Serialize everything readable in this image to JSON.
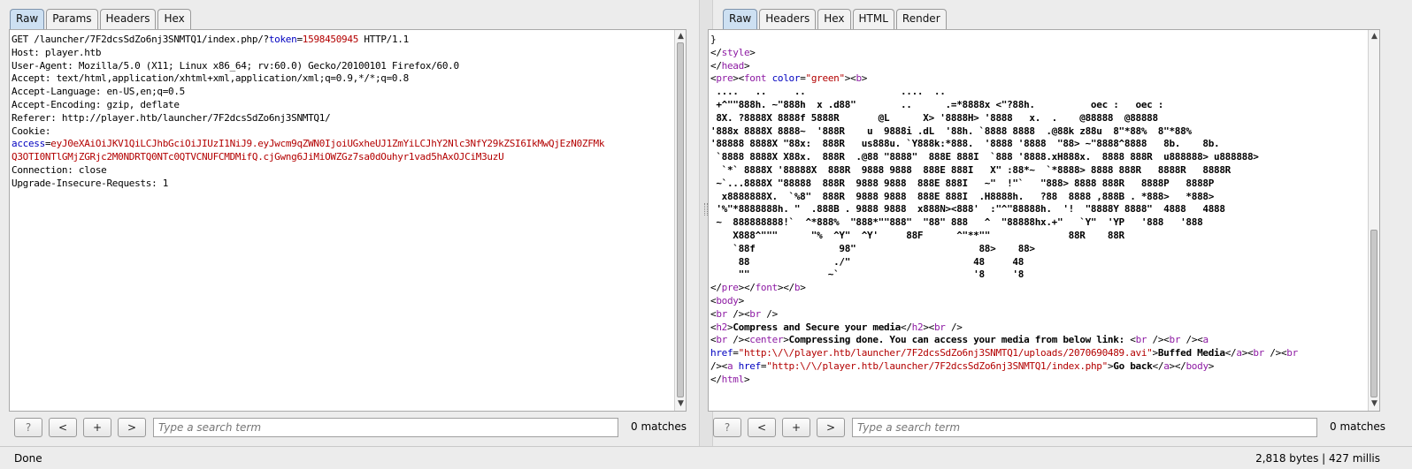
{
  "request": {
    "tabs": [
      "Raw",
      "Params",
      "Headers",
      "Hex"
    ],
    "active_tab": "Raw",
    "lines": [
      [
        {
          "t": "GET /launcher/7F2dcsSdZo6nj3SNMTQ1/index.php/?"
        },
        {
          "t": "token",
          "c": "blue"
        },
        {
          "t": "="
        },
        {
          "t": "1598450945",
          "c": "red"
        },
        {
          "t": " HTTP/1.1"
        }
      ],
      [
        {
          "t": "Host: player.htb"
        }
      ],
      [
        {
          "t": "User-Agent: Mozilla/5.0 (X11; Linux x86_64; rv:60.0) Gecko/20100101 Firefox/60.0"
        }
      ],
      [
        {
          "t": "Accept: text/html,application/xhtml+xml,application/xml;q=0.9,*/*;q=0.8"
        }
      ],
      [
        {
          "t": "Accept-Language: en-US,en;q=0.5"
        }
      ],
      [
        {
          "t": "Accept-Encoding: gzip, deflate"
        }
      ],
      [
        {
          "t": "Referer: http://player.htb/launcher/7F2dcsSdZo6nj3SNMTQ1/"
        }
      ],
      [
        {
          "t": "Cookie:"
        }
      ],
      [
        {
          "t": "access",
          "c": "blue"
        },
        {
          "t": "="
        },
        {
          "t": "eyJ0eXAiOiJKV1QiLCJhbGciOiJIUzI1NiJ9.eyJwcm9qZWN0IjoiUGxheUJ1ZmYiLCJhY2Nlc3NfY29kZSI6IkMwQjEzN0ZFMk",
          "c": "red"
        }
      ],
      [
        {
          "t": "Q3OTI0NTlGMjZGRjc2M0NDRTQ0NTc0QTVCNUFCMDMifQ.cjGwng6JiMiOWZGz7sa0dOuhyr1vad5hAxOJCiM3uzU",
          "c": "red"
        }
      ],
      [
        {
          "t": "Connection: close"
        }
      ],
      [
        {
          "t": "Upgrade-Insecure-Requests: 1"
        }
      ]
    ],
    "search_placeholder": "Type a search term",
    "matches": "0 matches"
  },
  "response": {
    "tabs": [
      "Raw",
      "Headers",
      "Hex",
      "HTML",
      "Render"
    ],
    "active_tab": "Raw",
    "lines": [
      [
        {
          "t": "}"
        }
      ],
      [
        {
          "t": "</"
        },
        {
          "t": "style",
          "c": "purple"
        },
        {
          "t": ">"
        }
      ],
      [
        {
          "t": "</"
        },
        {
          "t": "head",
          "c": "purple"
        },
        {
          "t": ">"
        }
      ],
      [
        {
          "t": "<"
        },
        {
          "t": "pre",
          "c": "purple"
        },
        {
          "t": "><"
        },
        {
          "t": "font",
          "c": "purple"
        },
        {
          "t": " "
        },
        {
          "t": "color",
          "c": "blue"
        },
        {
          "t": "="
        },
        {
          "t": "\"green\"",
          "c": "red"
        },
        {
          "t": "><"
        },
        {
          "t": "b",
          "c": "purple"
        },
        {
          "t": ">"
        }
      ],
      [
        {
          "t": " ....   ..     ..                 ....  ..",
          "c": "b"
        }
      ],
      [
        {
          "t": " +^\"\"888h. ~\"888h  x .d88\"        ..      .=*8888x <\"?88h.          oec :   oec :",
          "c": "b"
        }
      ],
      [
        {
          "t": " 8X. ?8888X 8888f 5888R       @L      X> '8888H> '8888   x.  .    @88888  @88888",
          "c": "b"
        }
      ],
      [
        {
          "t": "'888x 8888X 8888~  '888R    u  9888i .dL  '88h. `8888 8888  .@88k z88u  8\"*88%  8\"*88%",
          "c": "b"
        }
      ],
      [
        {
          "t": "'88888 8888X \"88x:  888R   us888u. `Y888k:*888.  '8888 '8888  \"88> ~\"8888^8888   8b.    8b.",
          "c": "b"
        }
      ],
      [
        {
          "t": " `8888 8888X X88x.  888R  .@88 \"8888\"  888E 888I  `888 '8888.xH888x.  8888 888R  u888888> u888888>",
          "c": "b"
        }
      ],
      [
        {
          "t": "  `*` 8888X '88888X  888R  9888 9888  888E 888I   X\" :88*~  `*8888> 8888 888R   8888R   8888R",
          "c": "b"
        }
      ],
      [
        {
          "t": " ~`...8888X \"88888  888R  9888 9888  888E 888I   ~\"  !\"`   \"888> 8888 888R   8888P   8888P",
          "c": "b"
        }
      ],
      [
        {
          "t": "  x8888888X.  `%8\"  888R  9888 9888  888E 888I  .H8888h.   ?88  8888 ,888B . *888>   *888>",
          "c": "b"
        }
      ],
      [
        {
          "t": " '%\"*8888888h. \"  .888B . 9888 9888  x888N><888'  :\"^\"88888h.  '!  \"8888Y 8888\"  4888   4888",
          "c": "b"
        }
      ],
      [
        {
          "t": " ~  888888888!`  ^*888%  \"888*\"\"888\"  \"88\" 888   ^  \"88888hx.+\"   `Y\"  'YP   '888   '888",
          "c": "b"
        }
      ],
      [
        {
          "t": "    X888^\"\"\"      \"%  ^Y\"  ^Y'     88F      ^\"**\"\"              88R    88R",
          "c": "b"
        }
      ],
      [
        {
          "t": "    `88f               98\"                      88>    88>",
          "c": "b"
        }
      ],
      [
        {
          "t": "     88               ./\"                      48     48",
          "c": "b"
        }
      ],
      [
        {
          "t": "     \"\"              ~`                        '8     '8",
          "c": "b"
        }
      ],
      [
        {
          "t": "</"
        },
        {
          "t": "pre",
          "c": "purple"
        },
        {
          "t": "></"
        },
        {
          "t": "font",
          "c": "purple"
        },
        {
          "t": "></"
        },
        {
          "t": "b",
          "c": "purple"
        },
        {
          "t": ">"
        }
      ],
      [
        {
          "t": "<"
        },
        {
          "t": "body",
          "c": "purple"
        },
        {
          "t": ">"
        }
      ],
      [
        {
          "t": "<"
        },
        {
          "t": "br",
          "c": "purple"
        },
        {
          "t": " /><"
        },
        {
          "t": "br",
          "c": "purple"
        },
        {
          "t": " />"
        }
      ],
      [
        {
          "t": "<"
        },
        {
          "t": "h2",
          "c": "purple"
        },
        {
          "t": ">"
        },
        {
          "t": "Compress and Secure your media",
          "c": "b"
        },
        {
          "t": "</"
        },
        {
          "t": "h2",
          "c": "purple"
        },
        {
          "t": "><"
        },
        {
          "t": "br",
          "c": "purple"
        },
        {
          "t": " />"
        }
      ],
      [
        {
          "t": "<"
        },
        {
          "t": "br",
          "c": "purple"
        },
        {
          "t": " /><"
        },
        {
          "t": "center",
          "c": "purple"
        },
        {
          "t": ">"
        },
        {
          "t": "Compressing done. You can access your media from below link: ",
          "c": "b"
        },
        {
          "t": "<"
        },
        {
          "t": "br",
          "c": "purple"
        },
        {
          "t": " /><"
        },
        {
          "t": "br",
          "c": "purple"
        },
        {
          "t": " /><"
        },
        {
          "t": "a",
          "c": "purple"
        }
      ],
      [
        {
          "t": "href",
          "c": "blue"
        },
        {
          "t": "="
        },
        {
          "t": "\"http:\\/\\/player.htb/launcher/7F2dcsSdZo6nj3SNMTQ1/uploads/2070690489.avi\"",
          "c": "red"
        },
        {
          "t": ">"
        },
        {
          "t": "Buffed Media",
          "c": "b"
        },
        {
          "t": "</"
        },
        {
          "t": "a",
          "c": "purple"
        },
        {
          "t": "><"
        },
        {
          "t": "br",
          "c": "purple"
        },
        {
          "t": " /><"
        },
        {
          "t": "br",
          "c": "purple"
        }
      ],
      [
        {
          "t": "/><"
        },
        {
          "t": "a",
          "c": "purple"
        },
        {
          "t": " "
        },
        {
          "t": "href",
          "c": "blue"
        },
        {
          "t": "="
        },
        {
          "t": "\"http:\\/\\/player.htb/launcher/7F2dcsSdZo6nj3SNMTQ1/index.php\"",
          "c": "red"
        },
        {
          "t": ">"
        },
        {
          "t": "Go back",
          "c": "b"
        },
        {
          "t": "</"
        },
        {
          "t": "a",
          "c": "purple"
        },
        {
          "t": "></"
        },
        {
          "t": "body",
          "c": "purple"
        },
        {
          "t": ">"
        }
      ],
      [
        {
          "t": "</"
        },
        {
          "t": "html",
          "c": "purple"
        },
        {
          "t": ">"
        }
      ]
    ],
    "search_placeholder": "Type a search term",
    "matches": "0 matches"
  },
  "search_buttons": {
    "help": "?",
    "prev": "<",
    "add": "+",
    "next": ">"
  },
  "status": {
    "left": "Done",
    "right": "2,818 bytes | 427 millis"
  }
}
